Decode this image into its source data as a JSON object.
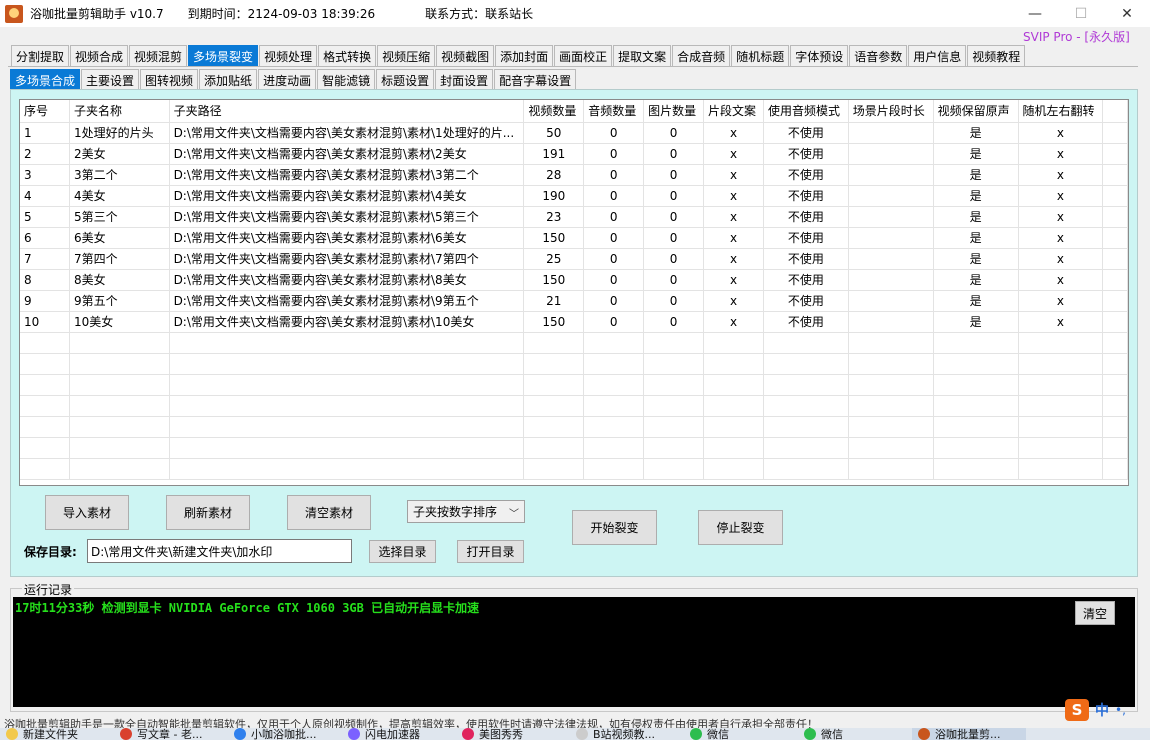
{
  "window": {
    "title": "浴咖批量剪辑助手 v10.7",
    "expiry": "到期时间：2124-09-03 18:39:26",
    "contact": "联系方式：联系站长",
    "minimize": "—",
    "maximize": "☐",
    "close": "✕"
  },
  "svip": "SVIP Pro - [永久版]",
  "tabs_main": [
    "分割提取",
    "视频合成",
    "视频混剪",
    "多场景裂变",
    "视频处理",
    "格式转换",
    "视频压缩",
    "视频截图",
    "添加封面",
    "画面校正",
    "提取文案",
    "合成音频",
    "随机标题",
    "字体预设",
    "语音参数",
    "用户信息",
    "视频教程"
  ],
  "tabs_main_active": 3,
  "tabs_sub": [
    "多场景合成",
    "主要设置",
    "图转视频",
    "添加贴纸",
    "进度动画",
    "智能滤镜",
    "标题设置",
    "封面设置",
    "配音字幕设置"
  ],
  "tabs_sub_active": 0,
  "table": {
    "headers": [
      "序号",
      "子夹名称",
      "子夹路径",
      "视频数量",
      "音频数量",
      "图片数量",
      "片段文案",
      "使用音频模式",
      "场景片段时长",
      "视频保留原声",
      "随机左右翻转"
    ],
    "rows": [
      [
        "1",
        "1处理好的片头",
        "D:\\常用文件夹\\文档需要内容\\美女素材混剪\\素材\\1处理好的片...",
        "50",
        "0",
        "0",
        "x",
        "不使用",
        "",
        "是",
        "x"
      ],
      [
        "2",
        "2美女",
        "D:\\常用文件夹\\文档需要内容\\美女素材混剪\\素材\\2美女",
        "191",
        "0",
        "0",
        "x",
        "不使用",
        "",
        "是",
        "x"
      ],
      [
        "3",
        "3第二个",
        "D:\\常用文件夹\\文档需要内容\\美女素材混剪\\素材\\3第二个",
        "28",
        "0",
        "0",
        "x",
        "不使用",
        "",
        "是",
        "x"
      ],
      [
        "4",
        "4美女",
        "D:\\常用文件夹\\文档需要内容\\美女素材混剪\\素材\\4美女",
        "190",
        "0",
        "0",
        "x",
        "不使用",
        "",
        "是",
        "x"
      ],
      [
        "5",
        "5第三个",
        "D:\\常用文件夹\\文档需要内容\\美女素材混剪\\素材\\5第三个",
        "23",
        "0",
        "0",
        "x",
        "不使用",
        "",
        "是",
        "x"
      ],
      [
        "6",
        "6美女",
        "D:\\常用文件夹\\文档需要内容\\美女素材混剪\\素材\\6美女",
        "150",
        "0",
        "0",
        "x",
        "不使用",
        "",
        "是",
        "x"
      ],
      [
        "7",
        "7第四个",
        "D:\\常用文件夹\\文档需要内容\\美女素材混剪\\素材\\7第四个",
        "25",
        "0",
        "0",
        "x",
        "不使用",
        "",
        "是",
        "x"
      ],
      [
        "8",
        "8美女",
        "D:\\常用文件夹\\文档需要内容\\美女素材混剪\\素材\\8美女",
        "150",
        "0",
        "0",
        "x",
        "不使用",
        "",
        "是",
        "x"
      ],
      [
        "9",
        "9第五个",
        "D:\\常用文件夹\\文档需要内容\\美女素材混剪\\素材\\9第五个",
        "21",
        "0",
        "0",
        "x",
        "不使用",
        "",
        "是",
        "x"
      ],
      [
        "10",
        "10美女",
        "D:\\常用文件夹\\文档需要内容\\美女素材混剪\\素材\\10美女",
        "150",
        "0",
        "0",
        "x",
        "不使用",
        "",
        "是",
        "x"
      ]
    ]
  },
  "buttons": {
    "import": "导入素材",
    "refresh": "刷新素材",
    "clear": "清空素材",
    "start": "开始裂变",
    "stop": "停止裂变",
    "choose_dir": "选择目录",
    "open_dir": "打开目录",
    "clear_log": "清空"
  },
  "sort_select": "子夹按数字排序",
  "save": {
    "label": "保存目录:",
    "value": "D:\\常用文件夹\\新建文件夹\\加水印"
  },
  "log": {
    "label": "运行记录",
    "line": "17时11分33秒 检测到显卡 NVIDIA GeForce GTX 1060 3GB 已自动开启显卡加速"
  },
  "status_text": "浴咖批量剪辑助手是一款全自动智能批量剪辑软件，仅用于个人原创视频制作，提高剪辑效率，使用软件时请遵守法律法规，如有侵权责任由使用者自行承担全部责任！",
  "ime": {
    "logo": "S",
    "lang": "中",
    "dots": "•,"
  },
  "taskbar": [
    "新建文件夹",
    "写文章 - 老...",
    "小咖浴咖批...",
    "闪电加速器",
    "美图秀秀",
    "B站视频教...",
    "微信",
    "微信",
    "浴咖批量剪..."
  ],
  "colors": {
    "accent": "#0a7ad6",
    "panel": "#cdf5f3",
    "log_text": "#26e01c",
    "svip": "#b03ad6"
  }
}
